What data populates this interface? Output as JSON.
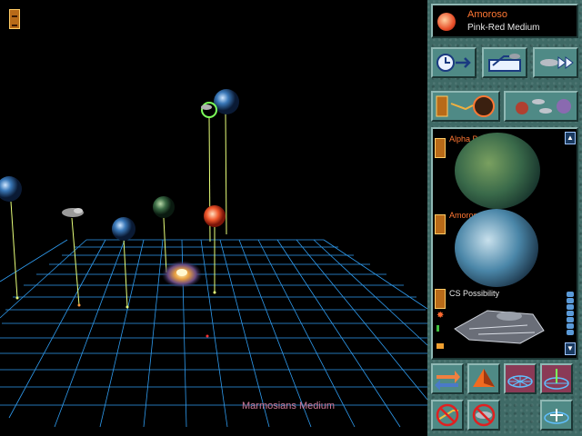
{
  "region": {
    "label": "Marmosians Medium"
  },
  "selected_star": {
    "name": "Amoroso",
    "classification": "Pink-Red Medium"
  },
  "toolbar": {
    "row1": [
      "time-advance-icon",
      "route-icon",
      "fleet-fast-forward-icon"
    ],
    "row2": [
      "orbit-view-icon",
      "fleet-group-icon"
    ]
  },
  "planet_list": {
    "items": [
      {
        "name": "Alpha Base",
        "icon": "planet-green-icon"
      },
      {
        "name": "Amoroso II",
        "icon": "planet-blue-icon"
      },
      {
        "name": "CS Possibility",
        "icon": "starship-icon"
      }
    ]
  },
  "bottom_controls": {
    "row1": [
      "swap-arrows-icon",
      "pyramid-icon",
      "grid-toggle-icon",
      "grid-axis-icon"
    ],
    "row2": [
      "no-travel-icon",
      "no-fleet-icon",
      "grid-zoom-icon"
    ]
  },
  "colors": {
    "panel": "#3f6a66",
    "grid": "#2fa6ff",
    "accent": "#ff7733",
    "stem": "#e8ff7a"
  }
}
